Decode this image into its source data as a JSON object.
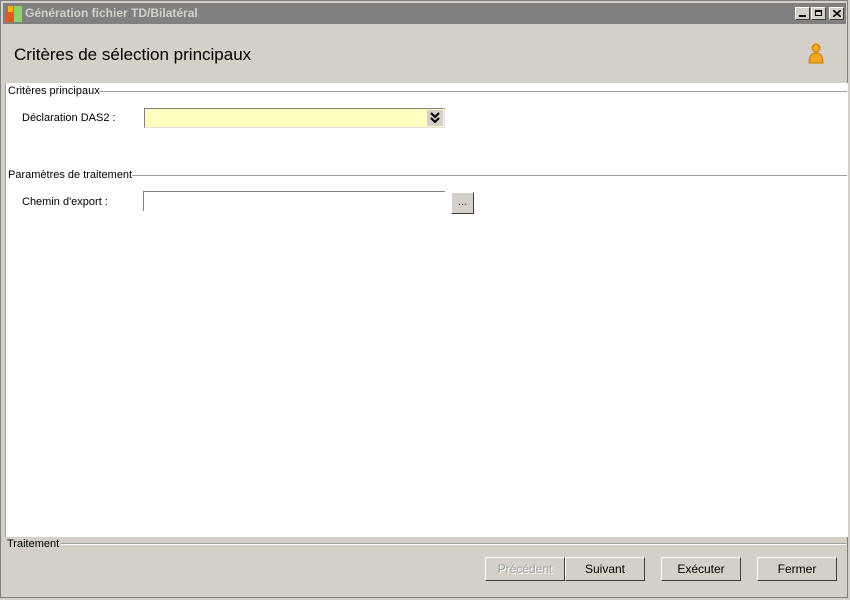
{
  "window": {
    "title": "Génération fichier TD/Bilatéral"
  },
  "header": {
    "title": "Critères de sélection principaux",
    "user_icon": "user-icon"
  },
  "groups": {
    "main_criteria": {
      "title": "Critères principaux",
      "declaration_label": "Déclaration DAS2 :",
      "declaration_value": ""
    },
    "processing": {
      "title": "Paramètres de traitement",
      "export_path_label": "Chemin d'export :",
      "export_path_value": "",
      "browse_label": "..."
    },
    "traitement": {
      "title": "Traitement"
    }
  },
  "buttons": {
    "previous": "Précédent",
    "next": "Suivant",
    "execute": "Exécuter",
    "close": "Fermer"
  },
  "colors": {
    "combo_background": "#ffffc0",
    "title_bar": "#808080",
    "window_background": "#d4d0c8"
  }
}
